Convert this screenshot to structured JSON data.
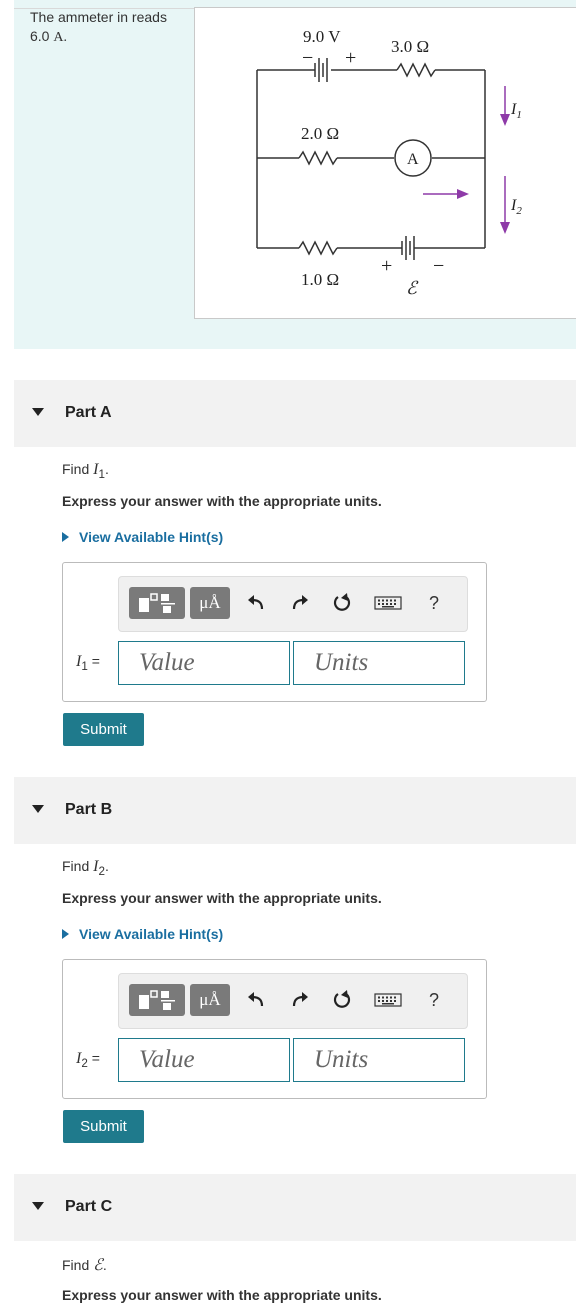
{
  "problem": {
    "text_prefix": "The ammeter in reads 6.0",
    "text_unit": "A.",
    "figure": {
      "battery1_label": "9.0 V",
      "resistor_top_label": "3.0 Ω",
      "resistor_mid_label": "2.0 Ω",
      "resistor_bot_label": "1.0 Ω",
      "ammeter_label": "A",
      "emf_label": "ℰ",
      "plus_sign": "+",
      "minus_sign": "−",
      "current1_symbol": "I",
      "current1_sub": "1",
      "current2_symbol": "I",
      "current2_sub": "2",
      "arrow_color": "#8e3aa8"
    }
  },
  "parts": [
    {
      "title": "Part A",
      "find_prefix": "Find",
      "find_symbol": "I",
      "find_sub": "1",
      "find_suffix": ".",
      "express": "Express your answer with the appropriate units.",
      "hint": "View Available Hint(s)",
      "var_symbol": "I",
      "var_sub": "1",
      "equals": "=",
      "value_placeholder": "Value",
      "units_placeholder": "Units",
      "toolbar_mu": "μÅ",
      "toolbar_help": "?",
      "submit": "Submit"
    },
    {
      "title": "Part B",
      "find_prefix": "Find",
      "find_symbol": "I",
      "find_sub": "2",
      "find_suffix": ".",
      "express": "Express your answer with the appropriate units.",
      "hint": "View Available Hint(s)",
      "var_symbol": "I",
      "var_sub": "2",
      "equals": "=",
      "value_placeholder": "Value",
      "units_placeholder": "Units",
      "toolbar_mu": "μÅ",
      "toolbar_help": "?",
      "submit": "Submit"
    },
    {
      "title": "Part C",
      "find_prefix": "Find",
      "find_symbol": "ℰ",
      "find_suffix": ".",
      "express": "Express your answer with the appropriate units."
    }
  ],
  "colors": {
    "accent": "#1f7a8c",
    "link": "#1a6ea0",
    "problem_bg": "#e8f6f6",
    "part_header_bg": "#f2f2f2"
  }
}
